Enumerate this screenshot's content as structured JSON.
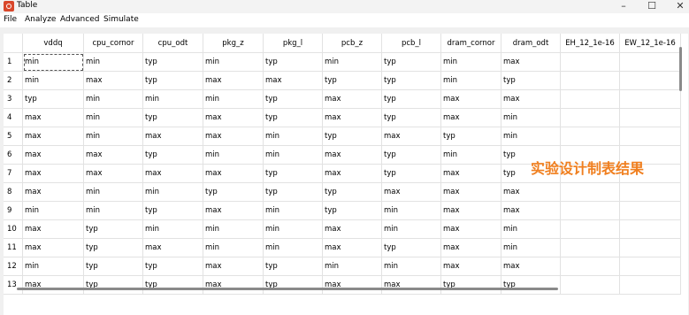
{
  "window": {
    "title": "Table",
    "minimize": "–",
    "maximize": "☐",
    "close": "✕"
  },
  "menu": [
    "File",
    "Analyze",
    "Advanced",
    "Simulate"
  ],
  "columns": [
    "vddq",
    "cpu_cornor",
    "cpu_odt",
    "pkg_z",
    "pkg_l",
    "pcb_z",
    "pcb_l",
    "dram_cornor",
    "dram_odt",
    "EH_12_1e-16",
    "EW_12_1e-16"
  ],
  "rows": [
    [
      "1",
      "min",
      "min",
      "typ",
      "min",
      "typ",
      "min",
      "typ",
      "min",
      "max",
      "",
      ""
    ],
    [
      "2",
      "min",
      "max",
      "typ",
      "max",
      "max",
      "typ",
      "typ",
      "min",
      "typ",
      "",
      ""
    ],
    [
      "3",
      "typ",
      "min",
      "min",
      "min",
      "typ",
      "max",
      "typ",
      "max",
      "max",
      "",
      ""
    ],
    [
      "4",
      "max",
      "min",
      "typ",
      "max",
      "typ",
      "max",
      "typ",
      "max",
      "min",
      "",
      ""
    ],
    [
      "5",
      "max",
      "min",
      "max",
      "max",
      "min",
      "typ",
      "max",
      "typ",
      "min",
      "",
      ""
    ],
    [
      "6",
      "max",
      "max",
      "typ",
      "min",
      "min",
      "max",
      "typ",
      "min",
      "typ",
      "",
      ""
    ],
    [
      "7",
      "max",
      "max",
      "max",
      "max",
      "typ",
      "max",
      "typ",
      "max",
      "typ",
      "",
      ""
    ],
    [
      "8",
      "max",
      "min",
      "min",
      "typ",
      "typ",
      "typ",
      "max",
      "max",
      "max",
      "",
      ""
    ],
    [
      "9",
      "min",
      "min",
      "typ",
      "max",
      "min",
      "typ",
      "min",
      "max",
      "max",
      "",
      ""
    ],
    [
      "10",
      "max",
      "typ",
      "min",
      "min",
      "min",
      "max",
      "min",
      "max",
      "min",
      "",
      ""
    ],
    [
      "11",
      "max",
      "typ",
      "max",
      "min",
      "min",
      "max",
      "typ",
      "max",
      "min",
      "",
      ""
    ],
    [
      "12",
      "min",
      "typ",
      "typ",
      "max",
      "typ",
      "min",
      "min",
      "max",
      "max",
      "",
      ""
    ],
    [
      "13",
      "max",
      "typ",
      "typ",
      "max",
      "typ",
      "max",
      "max",
      "typ",
      "typ",
      "",
      ""
    ]
  ],
  "overlay_text": "实验设计制表结果",
  "colors": {
    "overlay": "#f07f1f",
    "grid_line": "#e2e2e2",
    "app_icon": "#d9472b"
  }
}
